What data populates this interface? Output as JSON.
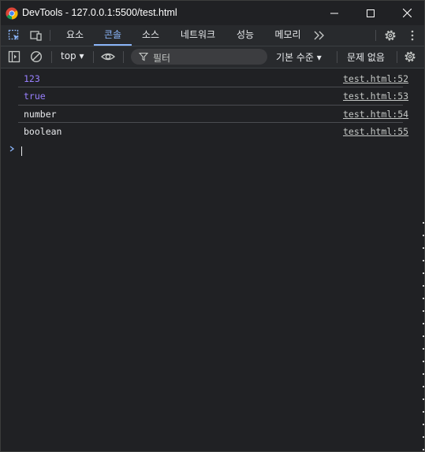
{
  "window": {
    "title": "DevTools - 127.0.0.1:5500/test.html"
  },
  "tabs": [
    {
      "label": "요소",
      "active": false
    },
    {
      "label": "콘솔",
      "active": true
    },
    {
      "label": "소스",
      "active": false
    },
    {
      "label": "네트워크",
      "active": false
    },
    {
      "label": "성능",
      "active": false
    },
    {
      "label": "메모리",
      "active": false
    }
  ],
  "toolbar": {
    "context": "top ▾",
    "filter_placeholder": "필터",
    "level": "기본 수준 ▾",
    "issues": "문제 없음"
  },
  "logs": [
    {
      "message": "123",
      "source": "test.html:52",
      "color": "#9980ff"
    },
    {
      "message": "true",
      "source": "test.html:53",
      "color": "#9980ff"
    },
    {
      "message": "number",
      "source": "test.html:54",
      "color": "#e8eaed"
    },
    {
      "message": "boolean",
      "source": "test.html:55",
      "color": "#e8eaed"
    }
  ],
  "colors": {
    "accent": "#8ab4f8",
    "background": "#202124",
    "toolbar": "#282a2d"
  }
}
